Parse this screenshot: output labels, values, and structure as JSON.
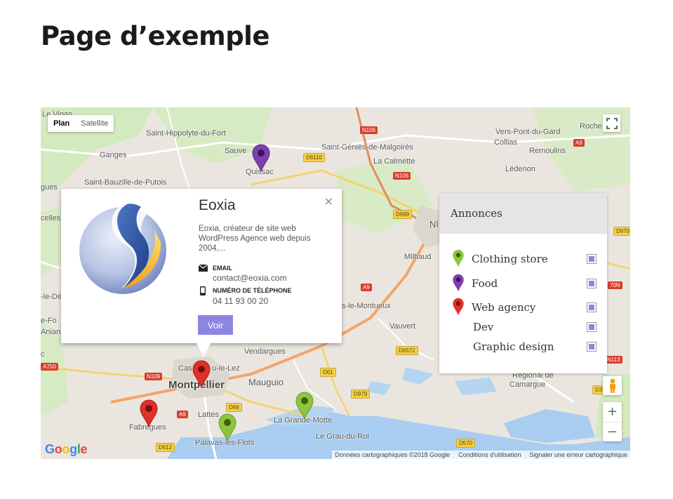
{
  "page": {
    "title": "Page d’exemple"
  },
  "map": {
    "type_controls": {
      "plan": "Plan",
      "satellite": "Satellite"
    },
    "places": {
      "le_vigan": "Le Vigan",
      "saint_hippolyte": "Saint-Hippolyte-du-Fort",
      "sauve": "Sauve",
      "quissac": "Quissac",
      "ganges": "Ganges",
      "saint_bauzille": "Saint-Bauzille-de-Putois",
      "saint_genies": "Saint-Géniès-de-Malgoirès",
      "la_calmette": "La Calmette",
      "vers_pont": "Vers-Pont-du-Gard",
      "collias": "Collias",
      "remoulins": "Remoulins",
      "roche": "Roche",
      "ledenon": "Lédenon",
      "nimes": "Nî",
      "milhaud": "Milhaud",
      "vauvert": "Vauvert",
      "montueux": "s-le-Montueux",
      "vendargues": "Vendargues",
      "castelnau": "Cas",
      "castelnau2": "u-le-Lez",
      "montpellier": "Montpellier",
      "mauguio": "Mauguio",
      "lattes": "Lattes",
      "fabregues": "Fabregues",
      "la_grande_motte": "La Grande-Motte",
      "le_grau": "Le Grau-du-Roi",
      "palavas": "Palavas-les-Flots",
      "camargue": "Camargue",
      "camargue2": "Régional de",
      "gues": "gues",
      "celles": "celles",
      "ledefo": "-le-Défo",
      "defoh": "e-Fo",
      "aniane": "Aniane",
      "c": "c"
    },
    "roads": {
      "n106a": "N106",
      "n106b": "N106",
      "d6110": "D6110",
      "a9a": "A9",
      "a9b": "A9",
      "a9c": "A9",
      "d999": "D999",
      "d970": "D970",
      "d6572": "D6572",
      "d61": "D61",
      "d979": "D979",
      "d66": "D66",
      "d612": "D612",
      "d570": "D570",
      "n109": "N109",
      "a750": "A750",
      "n113": "N113",
      "n70": "70N",
      "d35": "D35"
    },
    "attribution": {
      "data": "Données cartographiques ©2018 Google",
      "terms": "Conditions d'utilisation",
      "report": "Signaler une erreur cartographique"
    },
    "google_logo": "Google"
  },
  "infowindow": {
    "title": "Eoxia",
    "description": "Eoxia, créateur de site web WordPress Agence web depuis 2004,...",
    "email_label": "EMAIL",
    "email": "contact@eoxia.com",
    "phone_label": "NUMÉRO DE TÉLÉPHONE",
    "phone": "04 11 93 00 20",
    "button": "Voir",
    "close": "×"
  },
  "legend": {
    "title": "Annonces",
    "items": [
      {
        "label": "Clothing store",
        "color": "#8cc63f"
      },
      {
        "label": "Food",
        "color": "#7e3fb0"
      },
      {
        "label": "Web agency",
        "color": "#e0302b"
      },
      {
        "label": "Dev",
        "color": ""
      },
      {
        "label": "Graphic design",
        "color": ""
      }
    ]
  },
  "colors": {
    "accent": "#8c86e0",
    "water": "#a8cdf0",
    "green": "#cde8b6"
  },
  "controls": {
    "zoom_in": "+",
    "zoom_out": "−"
  }
}
